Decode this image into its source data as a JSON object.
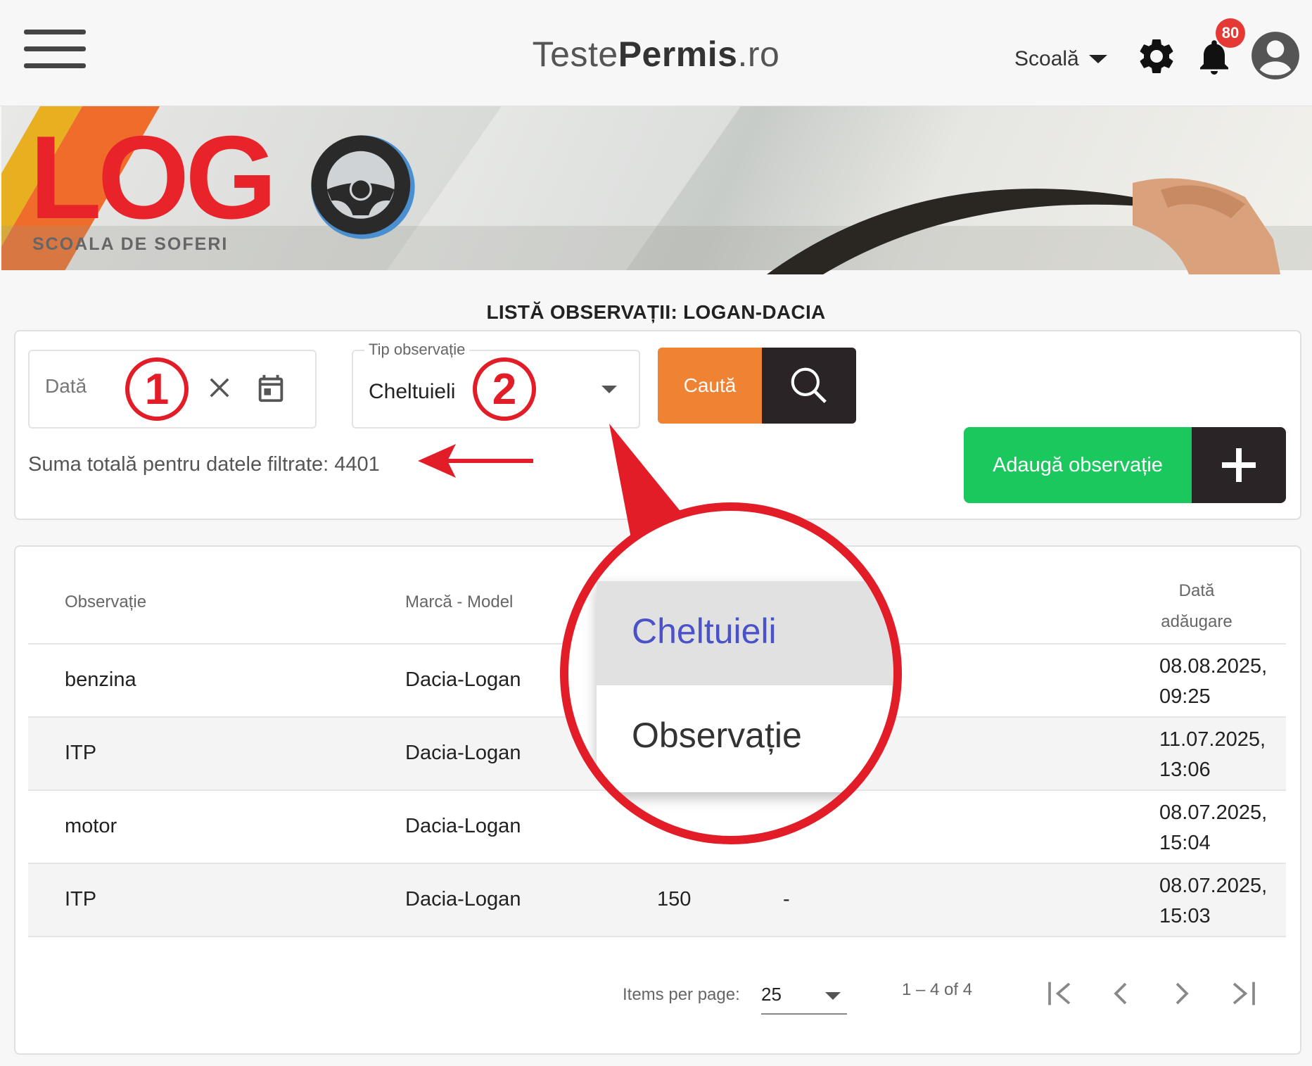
{
  "header": {
    "brand_part1": "Teste",
    "brand_part2": "Permis",
    "brand_part3": ".ro",
    "role": "Scoală",
    "notification_count": "80"
  },
  "banner": {
    "logo_text": "LOG",
    "logo_subtitle": "SCOALA DE SOFERI"
  },
  "page_title": "LISTĂ OBSERVAȚII: LOGAN-DACIA",
  "filters": {
    "date_placeholder": "Dată",
    "type_label": "Tip observație",
    "type_value": "Cheltuieli",
    "search_label": "Caută",
    "total_text": "Suma totală pentru datele filtrate: 4401",
    "add_label": "Adaugă observație"
  },
  "table": {
    "headers": {
      "observation": "Observație",
      "brand_model": "Marcă - Model",
      "date_added_line1": "Dată",
      "date_added_line2": "adăugare"
    },
    "rows": [
      {
        "observation": "benzina",
        "brand_model": "Dacia-Logan",
        "sum": "",
        "description": "",
        "date_line1": "08.08.2025,",
        "date_line2": "09:25"
      },
      {
        "observation": "ITP",
        "brand_model": "Dacia-Logan",
        "sum": "",
        "description": "",
        "date_line1": "11.07.2025,",
        "date_line2": "13:06"
      },
      {
        "observation": "motor",
        "brand_model": "Dacia-Logan",
        "sum": "",
        "description": "",
        "date_line1": "08.07.2025,",
        "date_line2": "15:04"
      },
      {
        "observation": "ITP",
        "brand_model": "Dacia-Logan",
        "sum": "150",
        "description": "-",
        "date_line1": "08.07.2025,",
        "date_line2": "15:03"
      }
    ]
  },
  "paginator": {
    "items_per_page_label": "Items per page:",
    "items_per_page_value": "25",
    "range_text": "1 – 4 of 4"
  },
  "annotations": {
    "badge1": "1",
    "badge2": "2",
    "dropdown_options": [
      "Cheltuieli",
      "Observație"
    ]
  },
  "colors": {
    "accent_orange": "#f08234",
    "accent_green": "#1bc85d",
    "dark": "#2b2426",
    "annotation_red": "#e21d27",
    "badge_red": "#e53935",
    "selected_option": "#4a52c8"
  },
  "icons": [
    "menu-icon",
    "gear-icon",
    "bell-icon",
    "account-icon",
    "clear-icon",
    "calendar-icon",
    "search-icon",
    "plus-icon",
    "first-page-icon",
    "prev-page-icon",
    "next-page-icon",
    "last-page-icon",
    "arrow-left-icon"
  ]
}
